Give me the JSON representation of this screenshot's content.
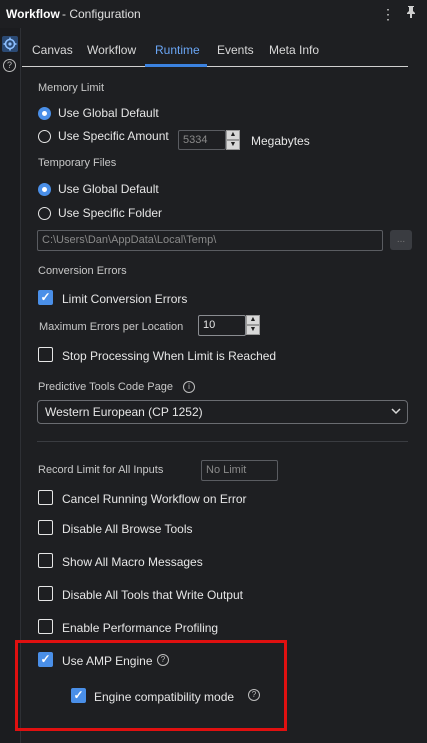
{
  "titlebar": {
    "app_name": "Workflow",
    "subtitle": "- Configuration",
    "menu_glyph": "⋮",
    "pin_glyph": "📌"
  },
  "rail": {
    "help_glyph": "?"
  },
  "tabs": [
    {
      "label": "Canvas",
      "active": false
    },
    {
      "label": "Workflow",
      "active": false
    },
    {
      "label": "Runtime",
      "active": true
    },
    {
      "label": "Events",
      "active": false
    },
    {
      "label": "Meta Info",
      "active": false
    }
  ],
  "memory": {
    "label": "Memory Limit",
    "global_default": "Use Global Default",
    "specific_amount": "Use Specific Amount",
    "amount_value": "5334",
    "unit": "Megabytes",
    "selected": "global_default"
  },
  "temp_files": {
    "label": "Temporary Files",
    "global_default": "Use Global Default",
    "specific_folder": "Use Specific Folder",
    "folder_value": "C:\\Users\\Dan\\AppData\\Local\\Temp\\",
    "browse_label": "...",
    "selected": "global_default"
  },
  "conversion": {
    "label": "Conversion Errors",
    "limit_errors": "Limit Conversion Errors",
    "limit_errors_checked": true,
    "max_errors_label": "Maximum Errors per Location",
    "max_errors_value": "10",
    "stop_processing": "Stop Processing When Limit is Reached",
    "stop_processing_checked": false
  },
  "predictive": {
    "label": "Predictive Tools Code Page",
    "info_glyph": "i",
    "selected_value": "Western European (CP 1252)"
  },
  "record_limit": {
    "label": "Record Limit for All Inputs",
    "placeholder": "No Limit"
  },
  "options": {
    "cancel_on_error": "Cancel Running Workflow on Error",
    "disable_browse": "Disable All Browse Tools",
    "show_macro_messages": "Show All Macro Messages",
    "disable_write_output": "Disable All Tools that Write Output",
    "enable_profiling": "Enable Performance Profiling"
  },
  "amp": {
    "use_amp": "Use AMP Engine",
    "use_amp_checked": true,
    "compat_mode": "Engine compatibility mode",
    "compat_mode_checked": true,
    "help_glyph": "?"
  },
  "colors": {
    "accent": "#4a8fe8",
    "highlight_border": "#e01010",
    "background": "#1e1f22"
  }
}
